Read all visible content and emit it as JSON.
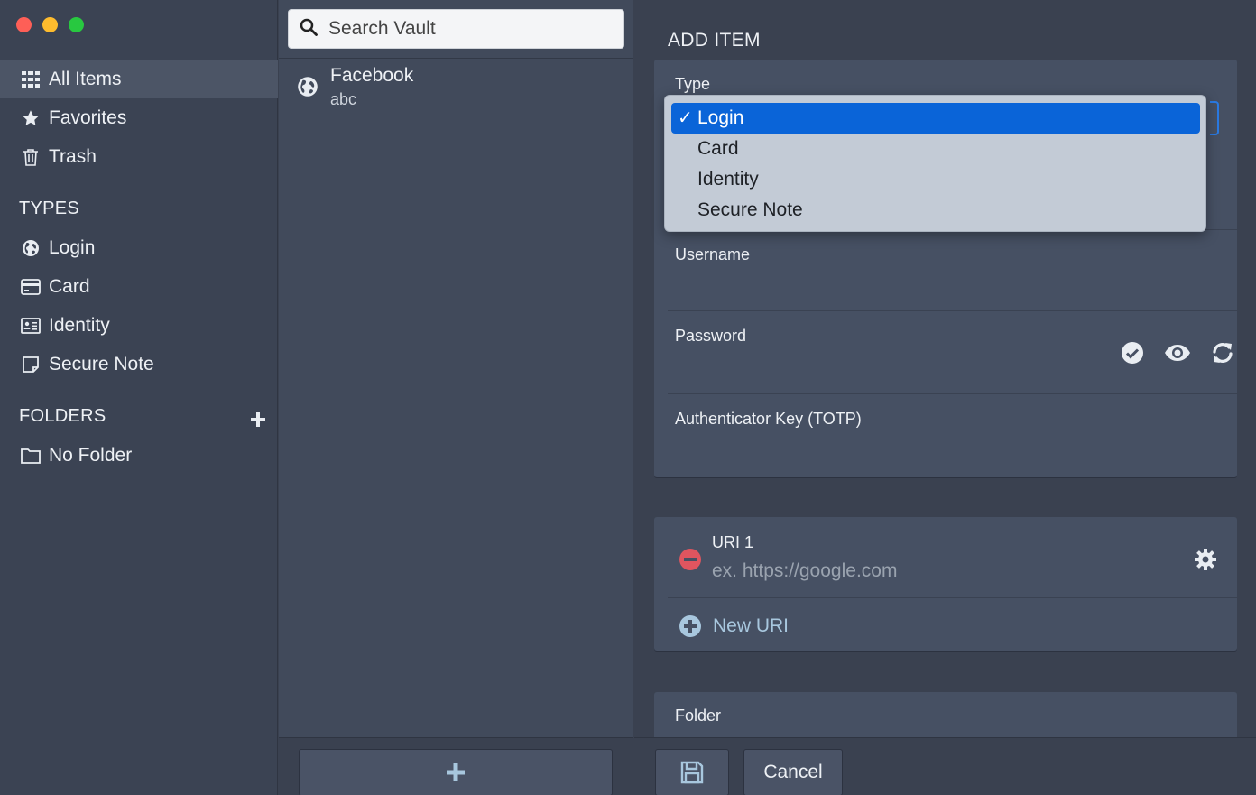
{
  "sidebar": {
    "nav": [
      {
        "label": "All Items",
        "icon": "grid-icon"
      },
      {
        "label": "Favorites",
        "icon": "star-icon"
      },
      {
        "label": "Trash",
        "icon": "trash-icon"
      }
    ],
    "types_heading": "TYPES",
    "types": [
      {
        "label": "Login",
        "icon": "globe-icon"
      },
      {
        "label": "Card",
        "icon": "credit-card-icon"
      },
      {
        "label": "Identity",
        "icon": "id-card-icon"
      },
      {
        "label": "Secure Note",
        "icon": "note-icon"
      }
    ],
    "folders_heading": "FOLDERS",
    "folders": [
      {
        "label": "No Folder",
        "icon": "folder-icon"
      }
    ]
  },
  "middle": {
    "search_placeholder": "Search Vault",
    "items": [
      {
        "title": "Facebook",
        "subtitle": "abc",
        "icon": "globe-icon"
      }
    ]
  },
  "editor": {
    "title": "ADD ITEM",
    "type_label": "Type",
    "username_label": "Username",
    "password_label": "Password",
    "totp_label": "Authenticator Key (TOTP)",
    "uri_label": "URI 1",
    "uri_placeholder": "ex. https://google.com",
    "new_uri_label": "New URI",
    "folder_label": "Folder",
    "cancel_label": "Cancel"
  },
  "type_dropdown": {
    "options": [
      "Login",
      "Card",
      "Identity",
      "Secure Note"
    ],
    "selected": "Login",
    "check_mark": "✓"
  },
  "colors": {
    "accent": "#0a64d8",
    "remove": "#e0555f",
    "link": "#a8c7de"
  }
}
